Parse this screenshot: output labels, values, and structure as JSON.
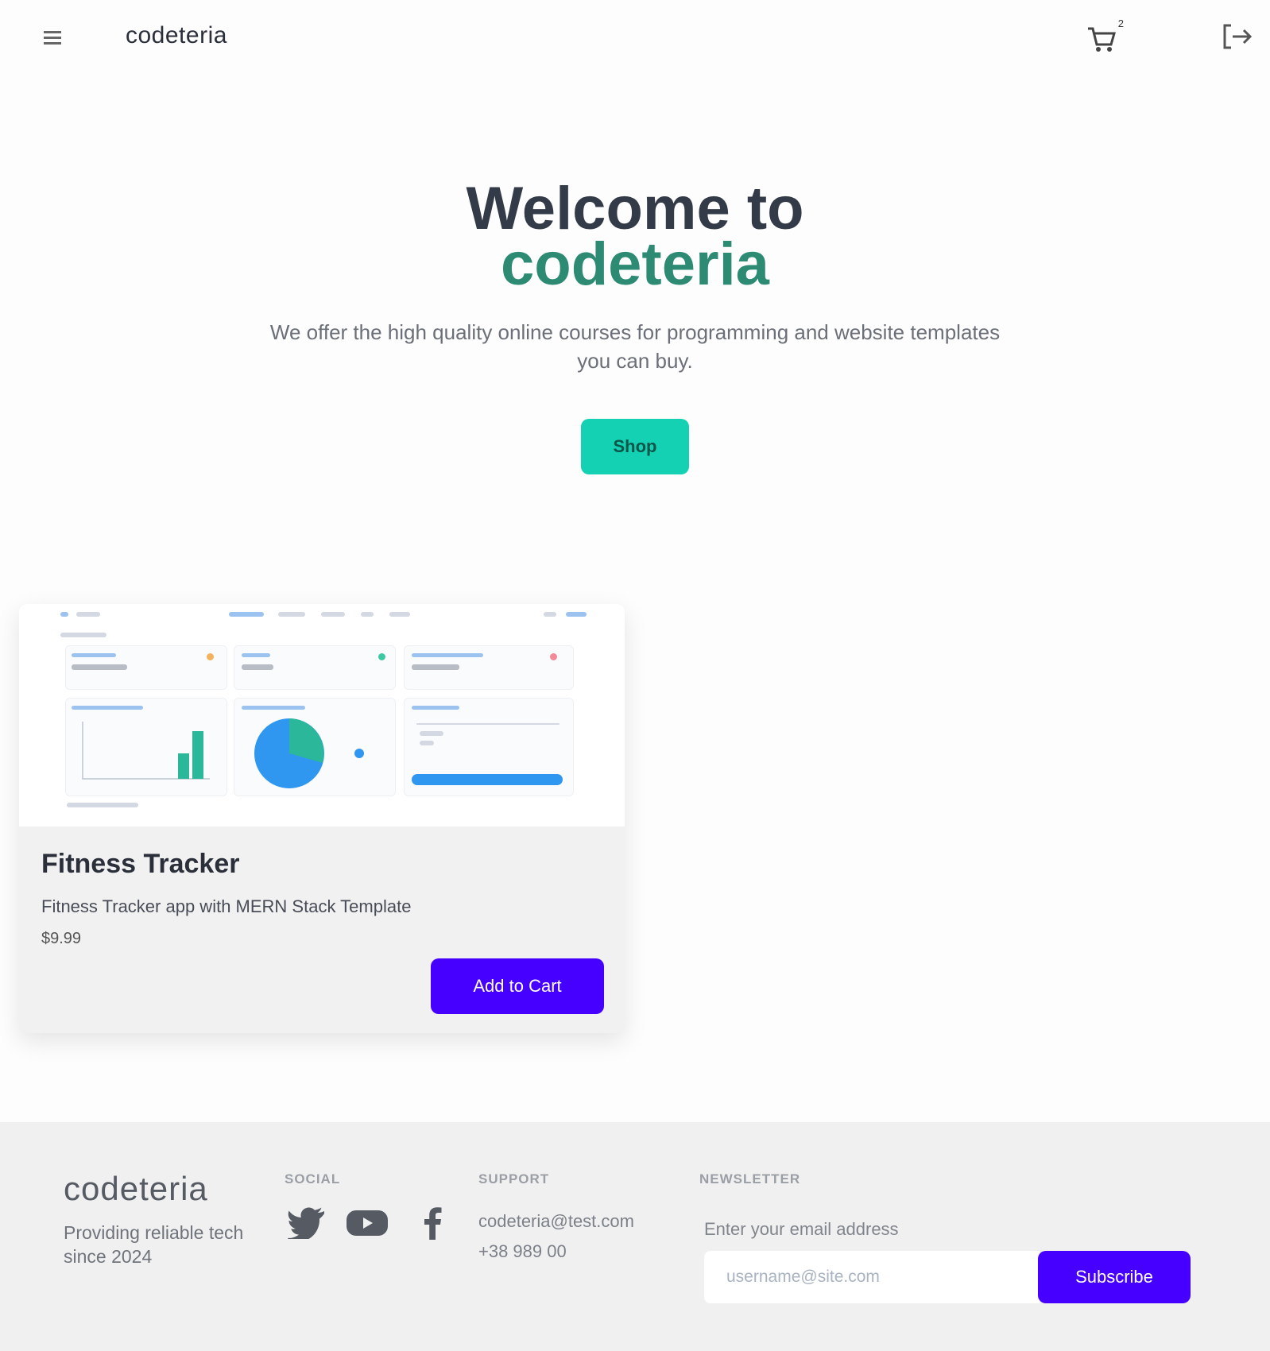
{
  "header": {
    "brand": "codeteria",
    "cart_count": "2"
  },
  "hero": {
    "title_line1": "Welcome to",
    "title_line2": "codeteria",
    "subtitle": "We offer the high quality online courses for programming and website templates you can buy.",
    "shop_label": "Shop"
  },
  "products": [
    {
      "title": "Fitness Tracker",
      "description": "Fitness Tracker app with MERN Stack Template",
      "price": "$9.99",
      "button_label": "Add to Cart"
    }
  ],
  "footer": {
    "brand": "codeteria",
    "tagline": "Providing reliable tech since 2024",
    "social_heading": "SOCIAL",
    "support_heading": "SUPPORT",
    "support_email": "codeteria@test.com",
    "support_phone": "+38 989 00",
    "newsletter_heading": "NEWSLETTER",
    "newsletter_prompt": "Enter your email address",
    "email_placeholder": "username@site.com",
    "subscribe_label": "Subscribe"
  },
  "colors": {
    "accent_teal": "#14d1b4",
    "brand_green": "#2d8a73",
    "button_purple": "#4600ff"
  },
  "icons": [
    "menu-icon",
    "cart-icon",
    "login-icon",
    "twitter-icon",
    "youtube-icon",
    "facebook-icon"
  ]
}
